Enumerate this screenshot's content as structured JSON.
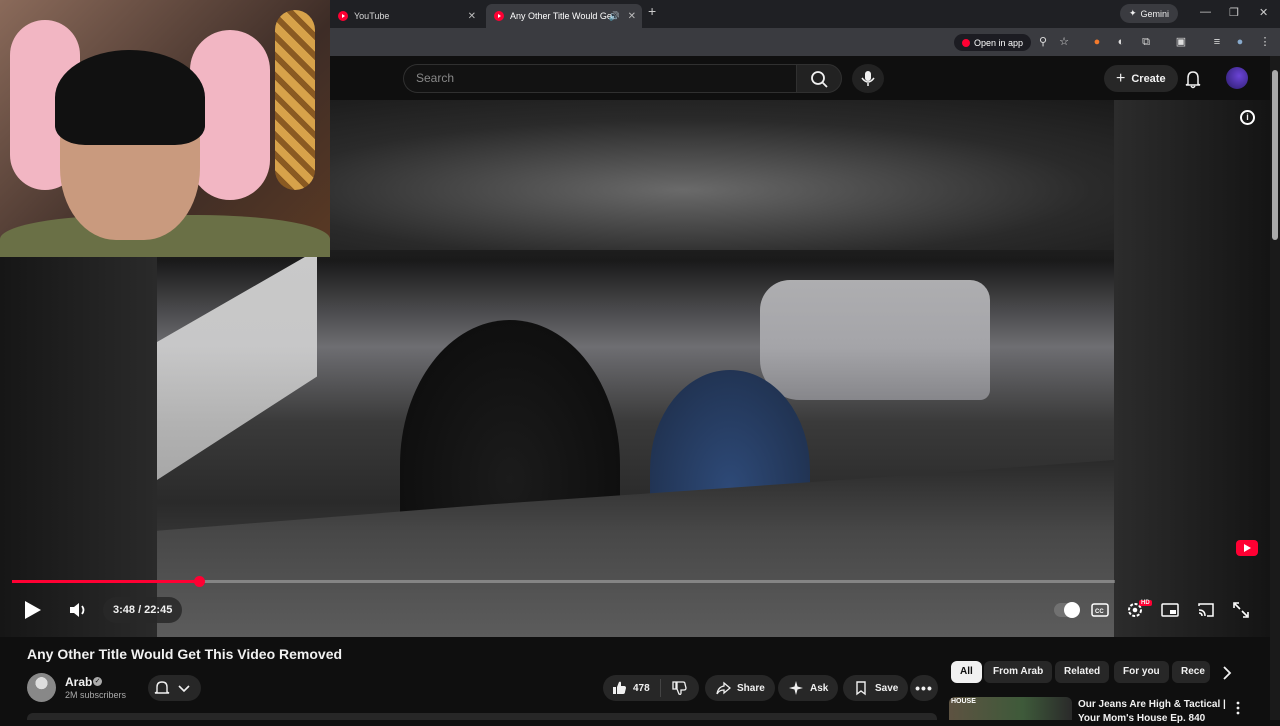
{
  "browser": {
    "tabs": [
      {
        "label": "YouTube",
        "active": false
      },
      {
        "label": "Any Other Title Would Get",
        "active": true
      }
    ],
    "gemini_label": "Gemini",
    "open_in_app_label": "Open in app"
  },
  "header": {
    "search_placeholder": "Search",
    "create_label": "Create"
  },
  "player": {
    "time_display": "3:48 / 22:45",
    "progress_fraction": 0.1692,
    "quality_badge": "HD"
  },
  "video": {
    "title": "Any Other Title Would Get This Video Removed",
    "channel_name": "Arab",
    "subscribers": "2M subscribers",
    "like_count": "478",
    "share_label": "Share",
    "ask_label": "Ask",
    "save_label": "Save"
  },
  "chips": [
    "All",
    "From Arab",
    "Related",
    "For you",
    "Rece"
  ],
  "recommendation": {
    "thumb_text": "HOUSE",
    "title": "Our Jeans Are High & Tactical | Your Mom's House Ep. 840"
  },
  "colors": {
    "accent": "#ff0033",
    "background": "#0f0f0f",
    "chip_bg": "#272727"
  }
}
